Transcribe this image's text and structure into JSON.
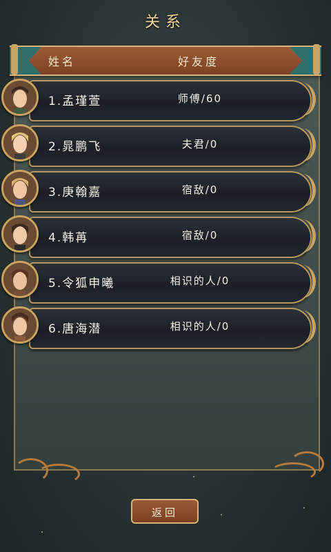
{
  "title": "关系",
  "header": {
    "name_label": "姓名",
    "friendship_label": "好友度"
  },
  "rows": [
    {
      "name": "1.孟瑾萱",
      "friendship": "师傅/60"
    },
    {
      "name": "2.晁鹏飞",
      "friendship": "夫君/0"
    },
    {
      "name": "3.庚翰嘉",
      "friendship": "宿敌/0"
    },
    {
      "name": "4.韩苒",
      "friendship": "宿敌/0"
    },
    {
      "name": "5.令狐申曦",
      "friendship": "相识的人/0"
    },
    {
      "name": "6.唐海潜",
      "friendship": "相识的人/0"
    }
  ],
  "back_label": "返回",
  "colors": {
    "accent_gold": "#c9a35f",
    "header_brown": "#8a4c2d",
    "teal": "#2e6f6c"
  }
}
